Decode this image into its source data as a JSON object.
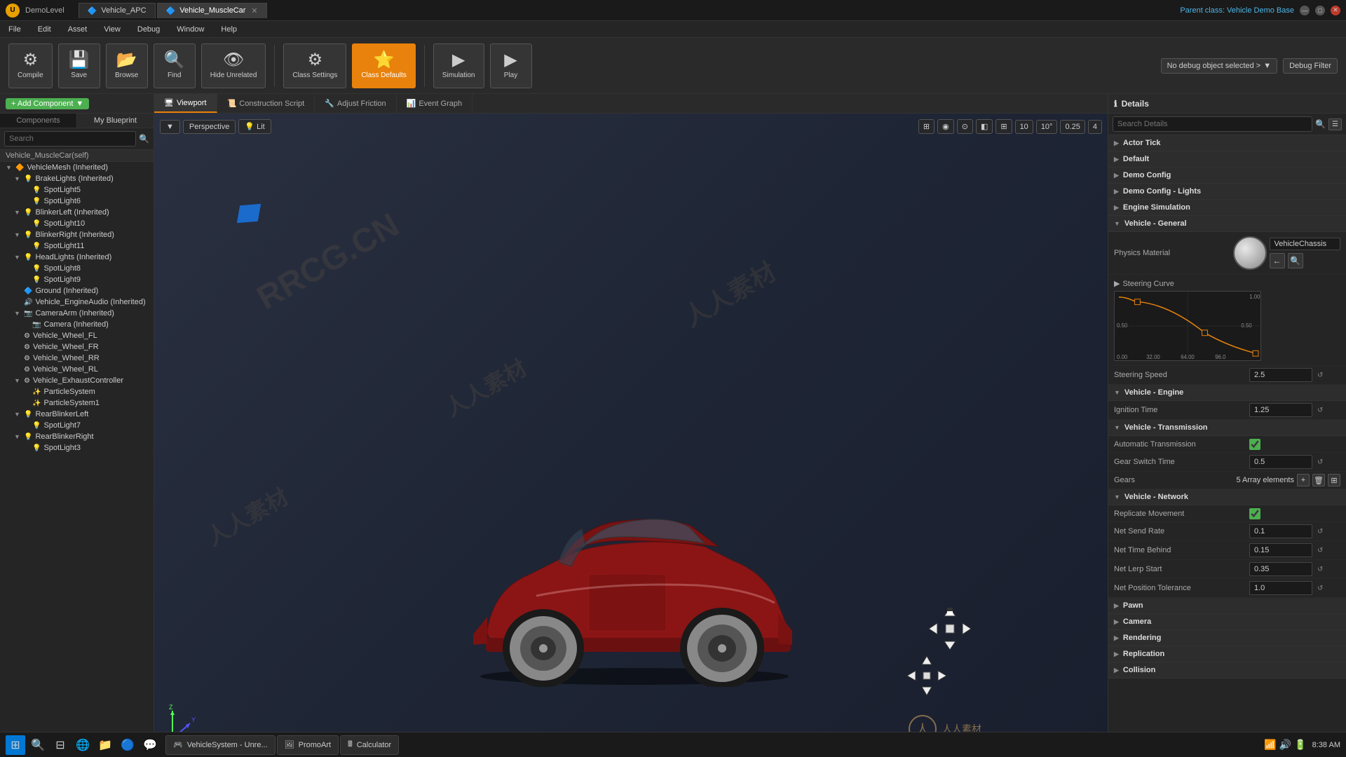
{
  "titlebar": {
    "logo": "U",
    "title": "DemoLevel",
    "tabs": [
      {
        "id": "vehicle-apc",
        "label": "Vehicle_APC",
        "icon": "🔷",
        "active": false
      },
      {
        "id": "vehicle-musclecar",
        "label": "Vehicle_MuscleCar",
        "icon": "🔷",
        "active": true
      }
    ],
    "parent_class_label": "Parent class:",
    "parent_class_value": "Vehicle Demo Base",
    "window_controls": [
      "—",
      "□",
      "✕"
    ]
  },
  "menubar": {
    "items": [
      "File",
      "Edit",
      "Asset",
      "View",
      "Debug",
      "Window",
      "Help"
    ]
  },
  "toolbar": {
    "buttons": [
      {
        "id": "compile",
        "label": "Compile",
        "icon": "⚙"
      },
      {
        "id": "save",
        "label": "Save",
        "icon": "💾"
      },
      {
        "id": "browse",
        "label": "Browse",
        "icon": "📂"
      },
      {
        "id": "find",
        "label": "Find",
        "icon": "🔍"
      },
      {
        "id": "hide-unrelated",
        "label": "Hide Unrelated",
        "icon": "👁"
      },
      {
        "id": "class-settings",
        "label": "Class Settings",
        "icon": "⚙"
      },
      {
        "id": "class-defaults",
        "label": "Class Defaults",
        "icon": "⭐",
        "active": true
      },
      {
        "id": "simulation",
        "label": "Simulation",
        "icon": "▶"
      },
      {
        "id": "play",
        "label": "Play",
        "icon": "▶"
      }
    ],
    "debug_object": "No debug object selected >",
    "debug_filter": "Debug Filter"
  },
  "left_panel": {
    "title": "Components",
    "add_button": "+ Add Component",
    "search_placeholder": "Search",
    "blueprint_tab": "My Blueprint",
    "self_label": "Vehicle_MuscleCar(self)",
    "tree_items": [
      {
        "id": "vehicle-mesh",
        "label": "VehicleMesh (Inherited)",
        "level": 0,
        "expanded": true,
        "icon": "🔶"
      },
      {
        "id": "brake-lights",
        "label": "BrakeLights (Inherited)",
        "level": 1,
        "expanded": true,
        "icon": "💡"
      },
      {
        "id": "spotlight5",
        "label": "SpotLight5",
        "level": 2,
        "icon": "💡"
      },
      {
        "id": "spotlight6",
        "label": "SpotLight6",
        "level": 2,
        "icon": "💡"
      },
      {
        "id": "blinker-left",
        "label": "BlinkerLeft (Inherited)",
        "level": 1,
        "expanded": true,
        "icon": "💡"
      },
      {
        "id": "spotlight10",
        "label": "SpotLight10",
        "level": 2,
        "icon": "💡"
      },
      {
        "id": "blinker-right",
        "label": "BlinkerRight (Inherited)",
        "level": 1,
        "expanded": true,
        "icon": "💡"
      },
      {
        "id": "spotlight11",
        "label": "SpotLight11",
        "level": 2,
        "icon": "💡"
      },
      {
        "id": "headlights",
        "label": "HeadLights (Inherited)",
        "level": 1,
        "expanded": true,
        "icon": "💡"
      },
      {
        "id": "spotlight8",
        "label": "SpotLight8",
        "level": 2,
        "icon": "💡"
      },
      {
        "id": "spotlight9",
        "label": "SpotLight9",
        "level": 2,
        "icon": "💡"
      },
      {
        "id": "ground",
        "label": "Ground (Inherited)",
        "level": 1,
        "icon": "🔷"
      },
      {
        "id": "engine-audio",
        "label": "Vehicle_EngineAudio (Inherited)",
        "level": 1,
        "icon": "🔊"
      },
      {
        "id": "camera-arm",
        "label": "CameraArm (Inherited)",
        "level": 1,
        "expanded": true,
        "icon": "📷"
      },
      {
        "id": "camera",
        "label": "Camera (Inherited)",
        "level": 2,
        "icon": "📷"
      },
      {
        "id": "wheel-fl",
        "label": "Vehicle_Wheel_FL",
        "level": 1,
        "icon": "⚙"
      },
      {
        "id": "wheel-fr",
        "label": "Vehicle_Wheel_FR",
        "level": 1,
        "icon": "⚙"
      },
      {
        "id": "wheel-rr",
        "label": "Vehicle_Wheel_RR",
        "level": 1,
        "icon": "⚙"
      },
      {
        "id": "wheel-rl",
        "label": "Vehicle_Wheel_RL",
        "level": 1,
        "icon": "⚙"
      },
      {
        "id": "exhaust-ctrl",
        "label": "Vehicle_ExhaustController",
        "level": 1,
        "expanded": true,
        "icon": "⚙"
      },
      {
        "id": "particle-sys",
        "label": "ParticleSystem",
        "level": 2,
        "icon": "✨"
      },
      {
        "id": "particle-sys1",
        "label": "ParticleSystem1",
        "level": 2,
        "icon": "✨"
      },
      {
        "id": "rear-blinker-left",
        "label": "RearBlinkerLeft",
        "level": 1,
        "expanded": true,
        "icon": "💡"
      },
      {
        "id": "spotlight7",
        "label": "SpotLight7",
        "level": 2,
        "icon": "💡"
      },
      {
        "id": "rear-blinker-right",
        "label": "RearBlinkerRight",
        "level": 1,
        "expanded": true,
        "icon": "💡"
      },
      {
        "id": "spotlight3",
        "label": "SpotLight3",
        "level": 2,
        "icon": "💡"
      }
    ]
  },
  "viewport": {
    "tabs": [
      {
        "id": "viewport",
        "label": "Viewport",
        "icon": "🖥",
        "active": true
      },
      {
        "id": "construction-script",
        "label": "Construction Script",
        "icon": "📜"
      },
      {
        "id": "adjust-friction",
        "label": "Adjust Friction",
        "icon": "🔧"
      },
      {
        "id": "event-graph",
        "label": "Event Graph",
        "icon": "📊"
      }
    ],
    "view_mode": "Perspective",
    "lit_mode": "Lit",
    "grid_value": "10",
    "angle_value": "10°",
    "scale_value": "0.25",
    "cam_speed": "4"
  },
  "right_panel": {
    "title": "Details",
    "search_placeholder": "Search Details",
    "sections": [
      {
        "id": "actor-tick",
        "label": "Actor Tick",
        "expanded": false
      },
      {
        "id": "default",
        "label": "Default",
        "expanded": false
      },
      {
        "id": "demo-config",
        "label": "Demo Config",
        "expanded": false
      },
      {
        "id": "demo-config-lights",
        "label": "Demo Config - Lights",
        "expanded": false
      },
      {
        "id": "engine-simulation",
        "label": "Engine Simulation",
        "expanded": false
      },
      {
        "id": "vehicle-general",
        "label": "Vehicle - General",
        "expanded": true
      },
      {
        "id": "vehicle-engine",
        "label": "Vehicle - Engine",
        "expanded": true
      },
      {
        "id": "vehicle-transmission",
        "label": "Vehicle - Transmission",
        "expanded": true
      },
      {
        "id": "vehicle-network",
        "label": "Vehicle - Network",
        "expanded": true
      },
      {
        "id": "pawn",
        "label": "Pawn",
        "expanded": false
      },
      {
        "id": "camera",
        "label": "Camera",
        "expanded": false
      },
      {
        "id": "rendering",
        "label": "Rendering",
        "expanded": false
      },
      {
        "id": "replication",
        "label": "Replication",
        "expanded": false
      },
      {
        "id": "collision",
        "label": "Collision",
        "expanded": false
      }
    ],
    "vehicle_general": {
      "physics_material_label": "Physics Material",
      "physics_material_value": "VehicleChassis",
      "steering_curve_label": "Steering Curve",
      "steering_speed_label": "Steering Speed",
      "steering_speed_value": "2.5",
      "curve_x_labels": [
        "0.00",
        "32.00",
        "64.00",
        "96.0",
        "1.00"
      ]
    },
    "vehicle_engine": {
      "ignition_time_label": "Ignition Time",
      "ignition_time_value": "1.25"
    },
    "vehicle_transmission": {
      "section_label": "Vehicle - Transmission",
      "auto_transmission_label": "Automatic Transmission",
      "auto_transmission_checked": true,
      "gear_switch_label": "Gear Switch Time",
      "gear_switch_value": "0.5",
      "gears_label": "Gears",
      "gears_value": "5 Array elements"
    },
    "vehicle_network": {
      "replicate_movement_label": "Replicate Movement",
      "replicate_movement_checked": true,
      "net_send_rate_label": "Net Send Rate",
      "net_send_rate_value": "0.1",
      "net_time_behind_label": "Net Time Behind",
      "net_time_behind_value": "0.15",
      "net_lerp_start_label": "Net Lerp Start",
      "net_lerp_start_value": "0.35",
      "net_position_tolerance_label": "Net Position Tolerance",
      "net_position_tolerance_value": "1.0"
    }
  },
  "taskbar": {
    "apps": [
      {
        "id": "vehicle-system",
        "label": "VehicleSystem - Unre...",
        "icon": "🎮"
      },
      {
        "id": "promo-art",
        "label": "PromoArt",
        "icon": "🖼"
      },
      {
        "id": "calculator",
        "label": "Calculator",
        "icon": "🖩"
      }
    ],
    "time": "8:38 AM"
  }
}
